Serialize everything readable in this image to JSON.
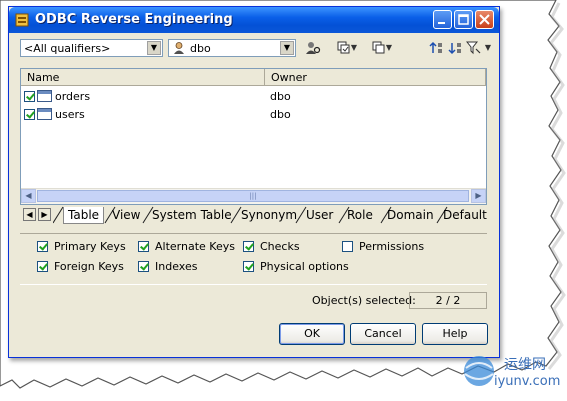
{
  "window": {
    "title": "ODBC Reverse Engineering"
  },
  "toolbar": {
    "qualifier_value": "<All qualifiers>",
    "owner_value": "dbo"
  },
  "list": {
    "columns": [
      "Name",
      "Owner"
    ],
    "rows": [
      {
        "name": "orders",
        "owner": "dbo",
        "checked": true
      },
      {
        "name": "users",
        "owner": "dbo",
        "checked": true
      }
    ],
    "scroll_grip": "|||"
  },
  "tabs": [
    "Table",
    "View",
    "System Table",
    "Synonym",
    "User",
    "Role",
    "Domain",
    "Default"
  ],
  "options": {
    "primary_keys": "Primary Keys",
    "alternate_keys": "Alternate Keys",
    "checks": "Checks",
    "permissions": "Permissions",
    "foreign_keys": "Foreign Keys",
    "indexes": "Indexes",
    "physical_options": "Physical options"
  },
  "status": {
    "label": "Object(s) selected:",
    "value": "2 / 2"
  },
  "buttons": {
    "ok": "OK",
    "cancel": "Cancel",
    "help": "Help"
  },
  "watermark": {
    "cn": "运维网",
    "en": "iyunv.com"
  },
  "colors": {
    "titlebar": "#0a5fe8",
    "window_bg": "#ece9d8",
    "check": "#21a121"
  }
}
